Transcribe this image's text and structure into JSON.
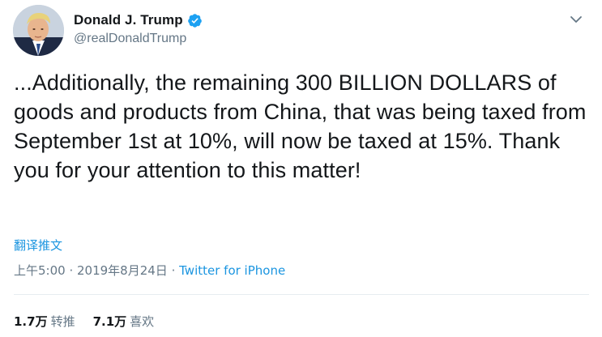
{
  "tweet": {
    "display_name": "Donald J. Trump",
    "handle": "@realDonaldTrump",
    "verified": true,
    "text": "...Additionally, the remaining 300 BILLION DOLLARS of goods and products from China, that was being taxed from September 1st at 10%, will now be taxed at 15%. Thank you for your attention to this matter!",
    "translate_label": "翻译推文",
    "time": "上午5:00",
    "separator1": " · ",
    "date": "2019年8月24日",
    "separator2": " · ",
    "source": "Twitter for iPhone",
    "retweets_count": "1.7万",
    "retweets_label": "转推",
    "likes_count": "7.1万",
    "likes_label": "喜欢"
  },
  "colors": {
    "link": "#1b95e0",
    "muted": "#657786",
    "text": "#14171a",
    "divider": "#e6ecf0"
  },
  "icons": {
    "verified": "verified-badge-icon",
    "caret": "chevron-down-icon"
  }
}
